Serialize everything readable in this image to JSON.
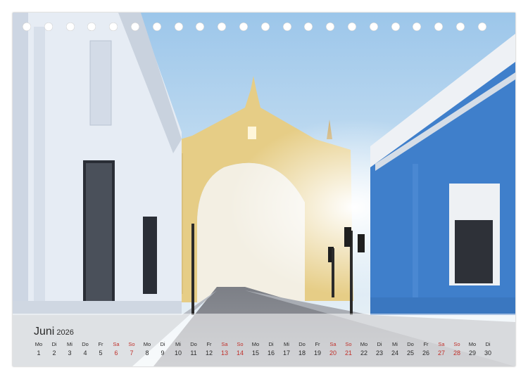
{
  "calendar": {
    "month": "Juni",
    "year": "2026",
    "days": [
      {
        "wd": "Mo",
        "d": "1",
        "we": false
      },
      {
        "wd": "Di",
        "d": "2",
        "we": false
      },
      {
        "wd": "Mi",
        "d": "3",
        "we": false
      },
      {
        "wd": "Do",
        "d": "4",
        "we": false
      },
      {
        "wd": "Fr",
        "d": "5",
        "we": false
      },
      {
        "wd": "Sa",
        "d": "6",
        "we": true
      },
      {
        "wd": "So",
        "d": "7",
        "we": true
      },
      {
        "wd": "Mo",
        "d": "8",
        "we": false
      },
      {
        "wd": "Di",
        "d": "9",
        "we": false
      },
      {
        "wd": "Mi",
        "d": "10",
        "we": false
      },
      {
        "wd": "Do",
        "d": "11",
        "we": false
      },
      {
        "wd": "Fr",
        "d": "12",
        "we": false
      },
      {
        "wd": "Sa",
        "d": "13",
        "we": true
      },
      {
        "wd": "So",
        "d": "14",
        "we": true
      },
      {
        "wd": "Mo",
        "d": "15",
        "we": false
      },
      {
        "wd": "Di",
        "d": "16",
        "we": false
      },
      {
        "wd": "Mi",
        "d": "17",
        "we": false
      },
      {
        "wd": "Do",
        "d": "18",
        "we": false
      },
      {
        "wd": "Fr",
        "d": "19",
        "we": false
      },
      {
        "wd": "Sa",
        "d": "20",
        "we": true
      },
      {
        "wd": "So",
        "d": "21",
        "we": true
      },
      {
        "wd": "Mo",
        "d": "22",
        "we": false
      },
      {
        "wd": "Di",
        "d": "23",
        "we": false
      },
      {
        "wd": "Mi",
        "d": "24",
        "we": false
      },
      {
        "wd": "Do",
        "d": "25",
        "we": false
      },
      {
        "wd": "Fr",
        "d": "26",
        "we": false
      },
      {
        "wd": "Sa",
        "d": "27",
        "we": true
      },
      {
        "wd": "So",
        "d": "28",
        "we": true
      },
      {
        "wd": "Mo",
        "d": "29",
        "we": false
      },
      {
        "wd": "Di",
        "d": "30",
        "we": false
      }
    ]
  },
  "colors": {
    "weekend": "#c0302a",
    "weekday": "#2a2a2a",
    "sky": "#b9d6ee",
    "arch": "#e8cf86",
    "blue_building": "#3f7fcb",
    "white_building": "#e6ecf4"
  }
}
